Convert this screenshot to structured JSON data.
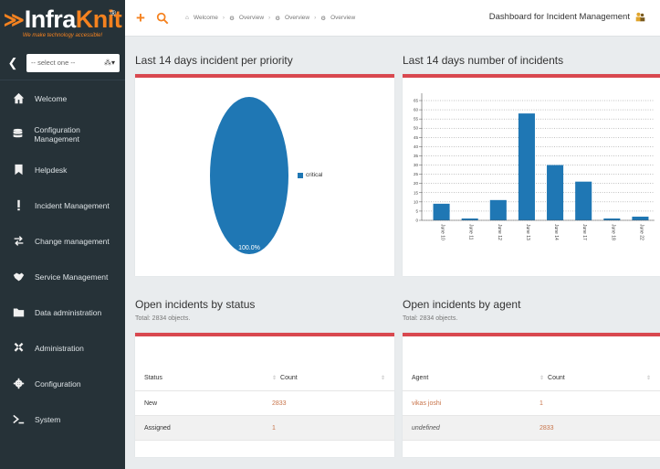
{
  "brand": {
    "name_part1": "Infra",
    "name_part2": "Knit",
    "registered": "®",
    "tagline": "We make technology accessible!"
  },
  "org_selector": {
    "placeholder": "-- select one --"
  },
  "sidebar": {
    "items": [
      {
        "label": "Welcome",
        "icon": "home-icon"
      },
      {
        "label": "Configuration Management",
        "icon": "database-icon"
      },
      {
        "label": "Helpdesk",
        "icon": "bookmark-icon"
      },
      {
        "label": "Incident Management",
        "icon": "exclamation-icon"
      },
      {
        "label": "Change management",
        "icon": "exchange-icon"
      },
      {
        "label": "Service Management",
        "icon": "handshake-icon"
      },
      {
        "label": "Data administration",
        "icon": "folder-icon"
      },
      {
        "label": "Administration",
        "icon": "tools-icon"
      },
      {
        "label": "Configuration",
        "icon": "gear-icon"
      },
      {
        "label": "System",
        "icon": "terminal-icon"
      }
    ]
  },
  "topbar": {
    "breadcrumb": [
      "Welcome",
      "Overview",
      "Overview",
      "Overview"
    ],
    "title": "Dashboard for Incident Management"
  },
  "panels": {
    "priority": {
      "title": "Last 14 days incident per priority"
    },
    "count": {
      "title": "Last 14 days number of incidents"
    },
    "status": {
      "title": "Open incidents by status",
      "total": "Total: 2834 objects."
    },
    "agent": {
      "title": "Open incidents by agent",
      "total": "Total: 2834 objects."
    }
  },
  "chart_data": [
    {
      "type": "pie",
      "title": "Last 14 days incident per priority",
      "categories": [
        "critical"
      ],
      "values": [
        100
      ],
      "labels": [
        "100.0%"
      ],
      "colors": [
        "#1f77b4"
      ],
      "legend": "right"
    },
    {
      "type": "bar",
      "title": "Last 14 days number of incidents",
      "categories": [
        "June 10",
        "June 11",
        "June 12",
        "June 13",
        "June 14",
        "June 17",
        "June 18",
        "June 22"
      ],
      "values": [
        9,
        1,
        11,
        58,
        30,
        21,
        1,
        2
      ],
      "ylim": [
        0,
        65
      ],
      "yticks": [
        "0",
        "5",
        "10",
        "15",
        "20",
        "25",
        "30",
        "35",
        "40",
        "45",
        "50",
        "55",
        "60",
        "65"
      ],
      "grid": true,
      "color": "#1f77b4"
    }
  ],
  "status_table": {
    "headers": [
      "Status",
      "Count"
    ],
    "rows": [
      {
        "label": "New",
        "count": "2833"
      },
      {
        "label": "Assigned",
        "count": "1"
      }
    ]
  },
  "agent_table": {
    "headers": [
      "Agent",
      "Count"
    ],
    "rows": [
      {
        "label": "vikas joshi",
        "count": "1"
      },
      {
        "label": "undefined",
        "count": "2833"
      }
    ]
  }
}
